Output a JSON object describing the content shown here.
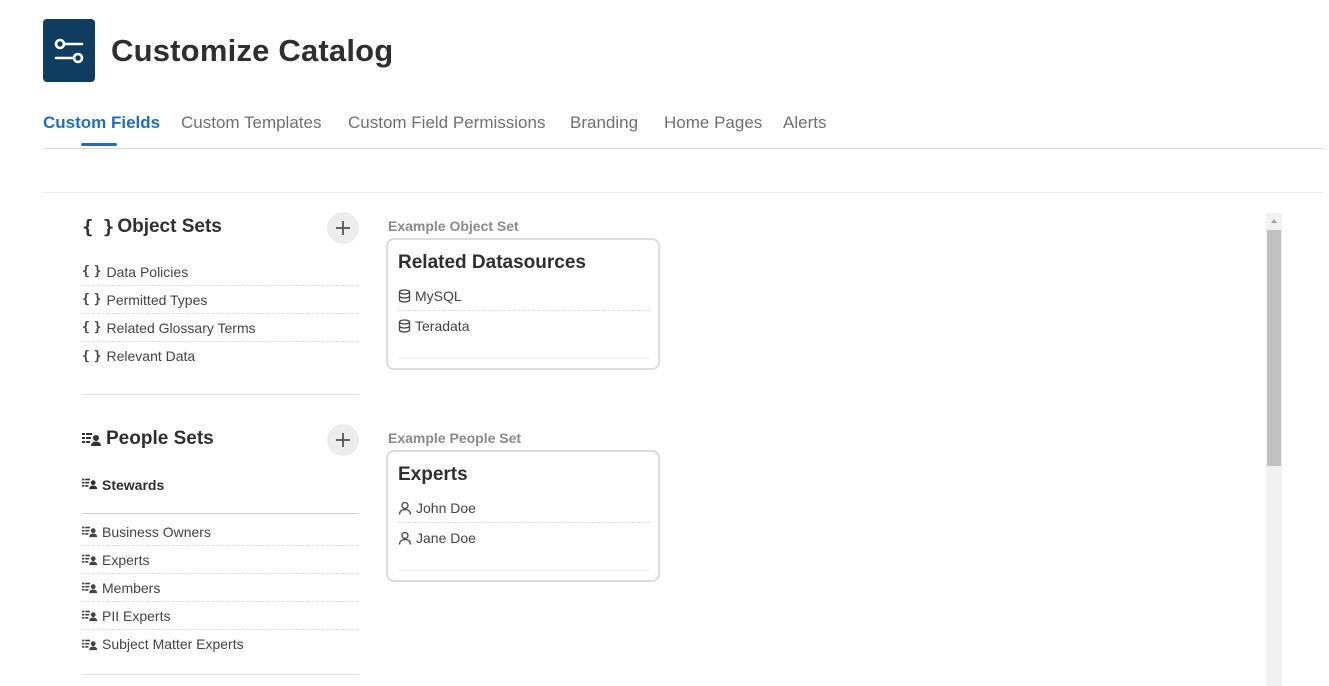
{
  "page": {
    "title": "Customize Catalog",
    "icon": "settings-sliders-icon"
  },
  "tabs": [
    {
      "label": "Custom Fields",
      "active": true
    },
    {
      "label": "Custom Templates",
      "active": false
    },
    {
      "label": "Custom Field Permissions",
      "active": false
    },
    {
      "label": "Branding",
      "active": false
    },
    {
      "label": "Home Pages",
      "active": false
    },
    {
      "label": "Alerts",
      "active": false
    }
  ],
  "object_sets": {
    "title": "Object Sets",
    "icon": "braces-icon",
    "items": [
      "Data Policies",
      "Permitted Types",
      "Related Glossary Terms",
      "Relevant Data"
    ],
    "example": {
      "label": "Example Object Set",
      "title": "Related Datasources",
      "rows": [
        "MySQL",
        "Teradata"
      ],
      "row_icon": "database-icon"
    }
  },
  "people_sets": {
    "title": "People Sets",
    "icon": "people-list-icon",
    "featured": "Stewards",
    "items": [
      "Business Owners",
      "Experts",
      "Members",
      "PII Experts",
      "Subject Matter Experts"
    ],
    "example": {
      "label": "Example People Set",
      "title": "Experts",
      "rows": [
        "John Doe",
        "Jane Doe"
      ],
      "row_icon": "user-icon"
    }
  },
  "colors": {
    "accent": "#1f6fbf",
    "brand": "#0e3d5f"
  }
}
